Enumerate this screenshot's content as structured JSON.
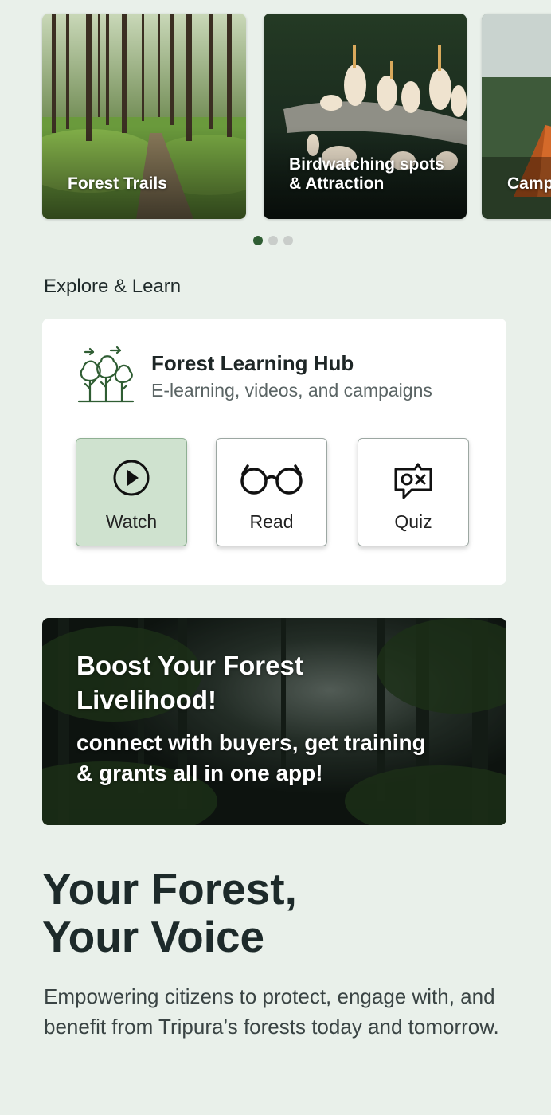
{
  "carousel": {
    "cards": [
      {
        "label": "Forest Trails"
      },
      {
        "label": "Birdwatching spots\n& Attraction"
      },
      {
        "label": "Camp"
      }
    ],
    "pagination": {
      "current": 1,
      "total": 3
    }
  },
  "explore": {
    "title": "Explore & Learn",
    "hub": {
      "icon": "forest-trees-icon",
      "title": "Forest Learning Hub",
      "subtitle": "E-learning, videos, and campaigns",
      "actions": [
        {
          "label": "Watch",
          "icon": "play-circle-icon",
          "active": true
        },
        {
          "label": "Read",
          "icon": "glasses-icon",
          "active": false
        },
        {
          "label": "Quiz",
          "icon": "quiz-chat-icon",
          "active": false
        }
      ]
    }
  },
  "banner": {
    "title": "Boost Your Forest\nLivelihood!",
    "text": "connect with buyers, get training\n& grants all in one app!"
  },
  "hero": {
    "title": "Your Forest,\nYour Voice",
    "text": "Empowering citizens to protect, engage with, and benefit from Tripura’s forests today and tomorrow."
  },
  "colors": {
    "background": "#e9f0ea",
    "accent": "#2f5d33",
    "active_button": "#cfe2cf"
  }
}
